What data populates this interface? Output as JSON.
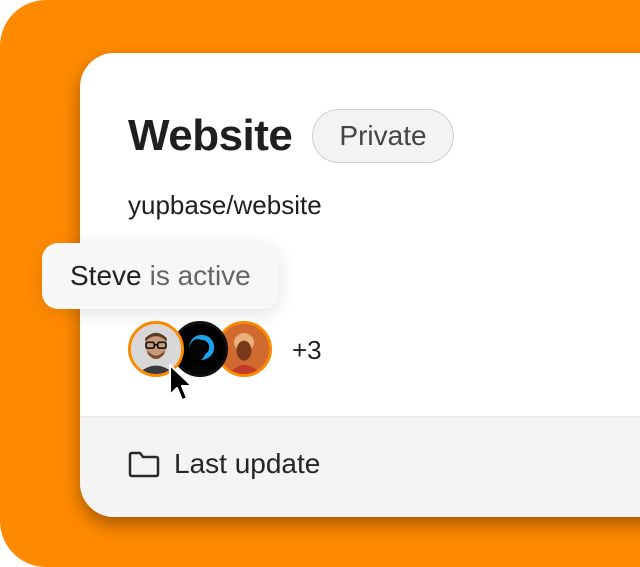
{
  "project": {
    "name": "Website",
    "visibility": "Private",
    "repo_path": "yupbase/website"
  },
  "tooltip": {
    "name": "Steve",
    "status": "is active"
  },
  "members": {
    "avatars": [
      {
        "name": "Steve",
        "icon": "avatar-man-glasses"
      },
      {
        "name": "",
        "icon": "avatar-silhouette-blue"
      },
      {
        "name": "",
        "icon": "avatar-woman-profile"
      }
    ],
    "extra_count": "+3"
  },
  "footer": {
    "label": "Last update",
    "icon": "folder-icon"
  },
  "colors": {
    "accent": "#FF8A00",
    "card_bg": "#FFFFFF",
    "footer_bg": "#F4F4F4",
    "text_primary": "#1F1F1F"
  }
}
